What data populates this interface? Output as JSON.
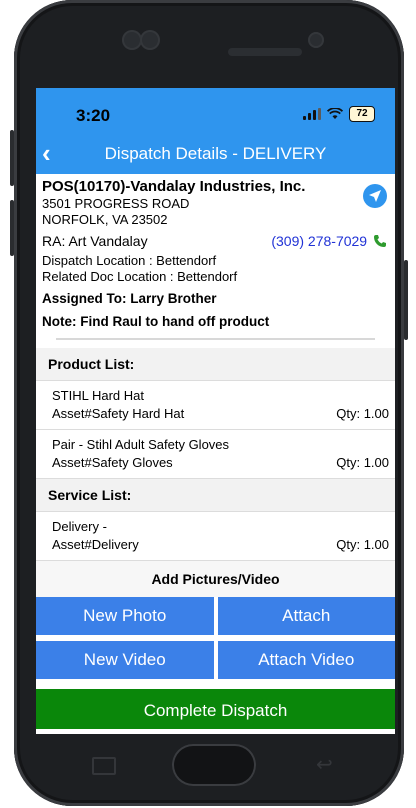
{
  "status_bar": {
    "time": "3:20",
    "battery": "72"
  },
  "nav": {
    "back_icon": "chevron-left",
    "title": "Dispatch Details - DELIVERY"
  },
  "dispatch": {
    "company": "POS(10170)-Vandalay Industries, Inc.",
    "address1": "3501 PROGRESS ROAD",
    "address2": "NORFOLK, VA 23502",
    "ra": "RA: Art Vandalay",
    "phone": "(309) 278-7029",
    "dispatch_location": "Dispatch Location : Bettendorf",
    "related_doc_location": "Related Doc Location : Bettendorf",
    "assigned_to": "Assigned To: Larry Brother",
    "note": "Note: Find Raul to hand off product"
  },
  "product_list": {
    "title": "Product List:",
    "items": [
      {
        "name": "STIHL Hard Hat",
        "asset": "Asset#Safety Hard Hat",
        "qty": "Qty: 1.00"
      },
      {
        "name": "Pair - Stihl Adult Safety Gloves",
        "asset": "Asset#Safety Gloves",
        "qty": "Qty: 1.00"
      }
    ]
  },
  "service_list": {
    "title": "Service List:",
    "items": [
      {
        "name": "Delivery -",
        "asset": "Asset#Delivery",
        "qty": "Qty: 1.00"
      }
    ]
  },
  "media": {
    "title": "Add Pictures/Video",
    "new_photo": "New Photo",
    "attach": "Attach",
    "new_video": "New Video",
    "attach_video": "Attach Video"
  },
  "complete_label": "Complete Dispatch",
  "colors": {
    "header": "#2f95ee",
    "button": "#3b80e8",
    "complete": "#0a870a",
    "phone_link": "#2133d6"
  }
}
